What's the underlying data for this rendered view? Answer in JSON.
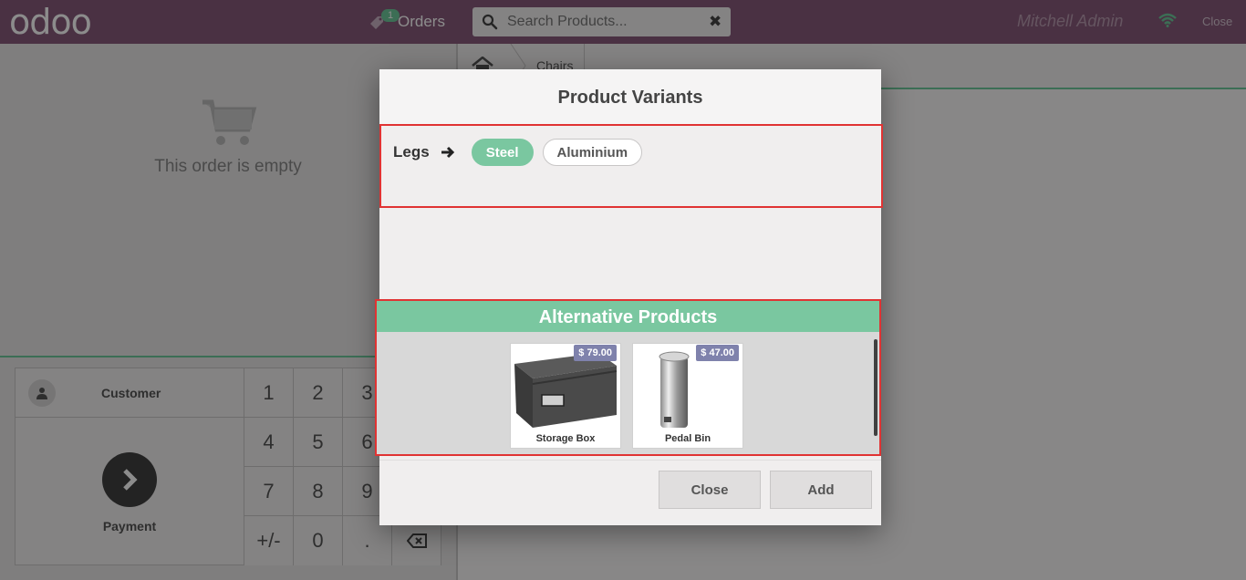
{
  "header": {
    "logo_text": "odoo",
    "orders_label": "Orders",
    "orders_count": "1",
    "search_placeholder": "Search Products...",
    "user_name": "Mitchell Admin",
    "close_label": "Close"
  },
  "order": {
    "empty_text": "This order is empty"
  },
  "controls": {
    "customer_label": "Customer",
    "payment_label": "Payment",
    "numpad": [
      "1",
      "2",
      "3",
      "4",
      "5",
      "6",
      "7",
      "8",
      "9",
      "+/-",
      "0",
      ".",
      "⌫"
    ]
  },
  "breadcrumb": {
    "category": "Chairs"
  },
  "modal": {
    "title": "Product Variants",
    "attribute_name": "Legs",
    "attribute_values": [
      "Steel",
      "Aluminium"
    ],
    "selected_value": "Steel",
    "alternatives_title": "Alternative Products",
    "alternatives": [
      {
        "name": "Storage Box",
        "price": "$ 79.00"
      },
      {
        "name": "Pedal Bin",
        "price": "$ 47.00"
      }
    ],
    "close_label": "Close",
    "add_label": "Add"
  },
  "colors": {
    "brand": "#875a7b",
    "accent": "#7ac7a0",
    "price_tag": "#7f82ac",
    "highlight_border": "#e03333"
  }
}
